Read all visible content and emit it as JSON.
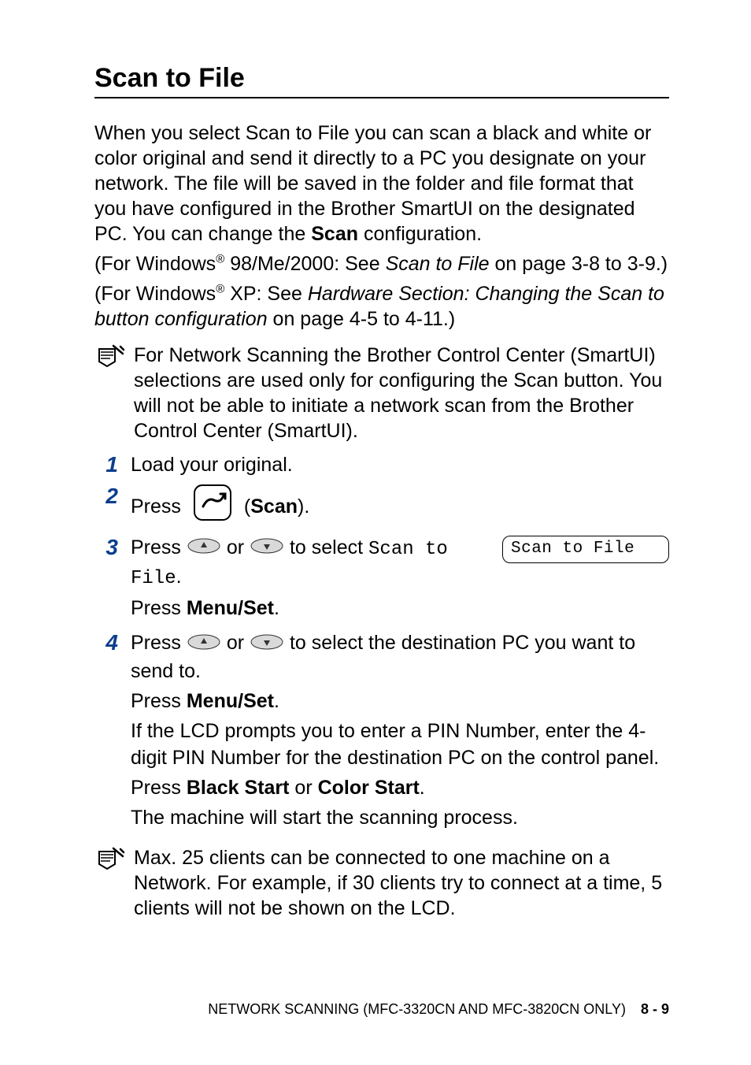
{
  "title": "Scan to File",
  "intro": {
    "p1a": "When you select Scan to File you can scan a black and white or color original and send it directly to a PC you designate on your network. The file will be saved in the folder and file format that you have configured in the Brother SmartUI on the designated PC. You can change the ",
    "p1_bold": "Scan",
    "p1b": " configuration.",
    "p2a": "(For Windows",
    "p2_sup": "®",
    "p2b": " 98/Me/2000: See ",
    "p2_italic": "Scan to File",
    "p2c": " on page 3-8 to 3-9.)",
    "p3a": "(For Windows",
    "p3_sup": "®",
    "p3b": " XP: See ",
    "p3_italic": "Hardware Section: Changing the Scan to button configuration",
    "p3c": " on page 4-5 to 4-11.)"
  },
  "note1": "For Network Scanning the Brother Control Center (SmartUI) selections are used only for configuring the Scan button. You will not be able to initiate a network scan from the Brother Control Center (SmartUI).",
  "steps": {
    "s1": {
      "num": "1",
      "text": "Load your original."
    },
    "s2": {
      "num": "2",
      "press": "Press",
      "paren_open": "(",
      "scan": "Scan",
      "paren_close": ")."
    },
    "s3": {
      "num": "3",
      "press": "Press ",
      "or": " or ",
      "to_select": " to select ",
      "mono1": "Scan to File",
      "dot": ".",
      "press_menu": "Press ",
      "menu_set": "Menu/Set",
      "dot2": ".",
      "lcd": "Scan to File"
    },
    "s4": {
      "num": "4",
      "l1a": "Press ",
      "l1_or": " or ",
      "l1b": " to select the destination PC you want to send to.",
      "l2a": "Press ",
      "l2_bold": "Menu/Set",
      "l2b": ".",
      "l3": "If the LCD prompts you to enter a PIN Number, enter the 4-digit PIN Number for the destination PC on the control panel.",
      "l4a": "Press ",
      "l4_bold1": "Black Start",
      "l4_mid": " or ",
      "l4_bold2": "Color Start",
      "l4b": ".",
      "l5": "The machine will start the scanning process."
    }
  },
  "note2": "Max. 25 clients can be connected to one machine on a Network. For example, if 30 clients try to connect at a time, 5 clients will not be shown on the LCD.",
  "footer": {
    "label": "NETWORK SCANNING (MFC-3320CN AND MFC-3820CN ONLY)",
    "page": "8 - 9"
  }
}
